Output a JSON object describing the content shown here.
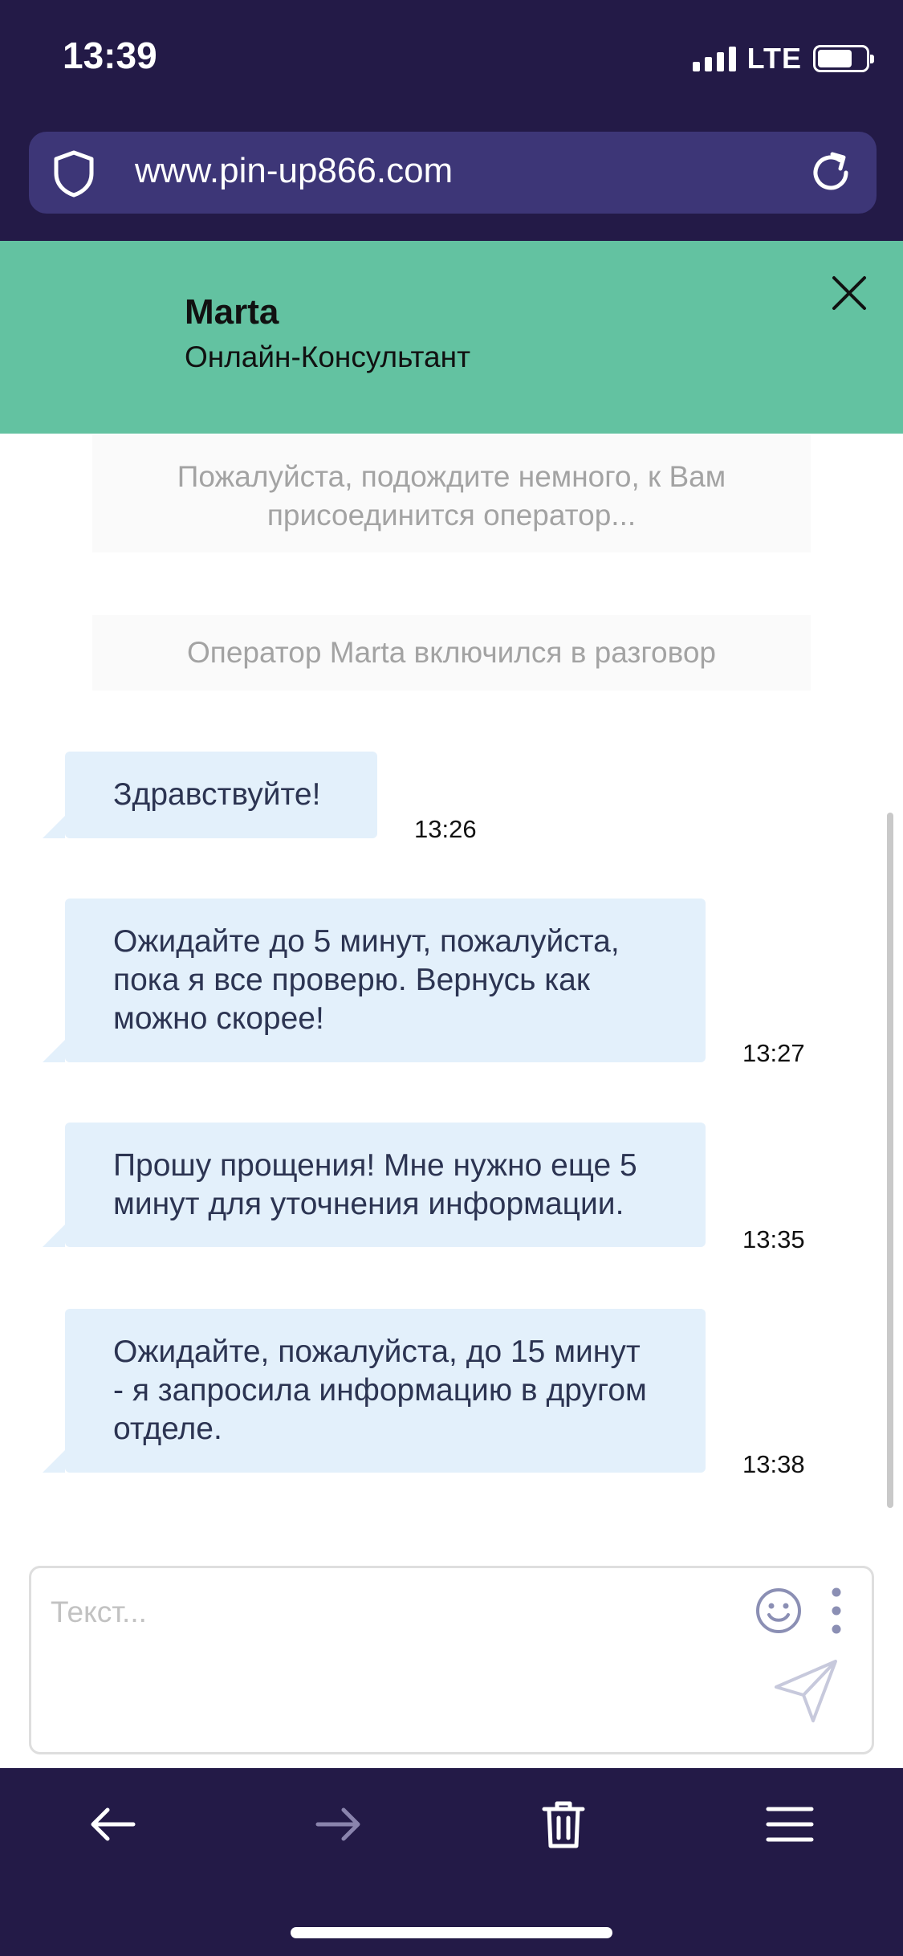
{
  "status_bar": {
    "time": "13:39",
    "network": "LTE"
  },
  "browser": {
    "url": "www.pin-up866.com"
  },
  "chat_header": {
    "agent_name": "Marta",
    "agent_role": "Онлайн-Консультант"
  },
  "system_messages": [
    "Пожалуйста, подождите немного, к Вам присоединится оператор...",
    "Оператор Marta включился в разговор"
  ],
  "messages": [
    {
      "text": "Здравствуйте!",
      "time": "13:26"
    },
    {
      "text": "Ожидайте до 5 минут, пожалуйста,\nпока я все проверю. Вернусь как\nможно скорее!",
      "time": "13:27"
    },
    {
      "text": "Прошу прощения! Мне нужно еще 5\nминут для уточнения информации.",
      "time": "13:35"
    },
    {
      "text": "Ожидайте, пожалуйста, до 15 минут\n- я запросила информацию в другом\nотделе.",
      "time": "13:38"
    }
  ],
  "input": {
    "placeholder": "Текст..."
  },
  "icons": {
    "status": [
      "signal-icon",
      "battery-icon"
    ],
    "url_bar": [
      "shield-icon",
      "reload-icon"
    ],
    "header": [
      "close-icon"
    ],
    "input": [
      "emoji-icon",
      "more-vertical-icon",
      "send-icon"
    ],
    "toolbar": [
      "arrow-left-icon",
      "arrow-right-icon",
      "trash-icon",
      "menu-icon"
    ]
  },
  "colors": {
    "browser_bg": "#231a47",
    "url_bar_bg": "#3d3677",
    "chat_header_bg": "#63c2a1",
    "bubble_bg": "#e3f0fb",
    "bubble_text": "#2c3452",
    "system_text": "#a3a3a3"
  }
}
